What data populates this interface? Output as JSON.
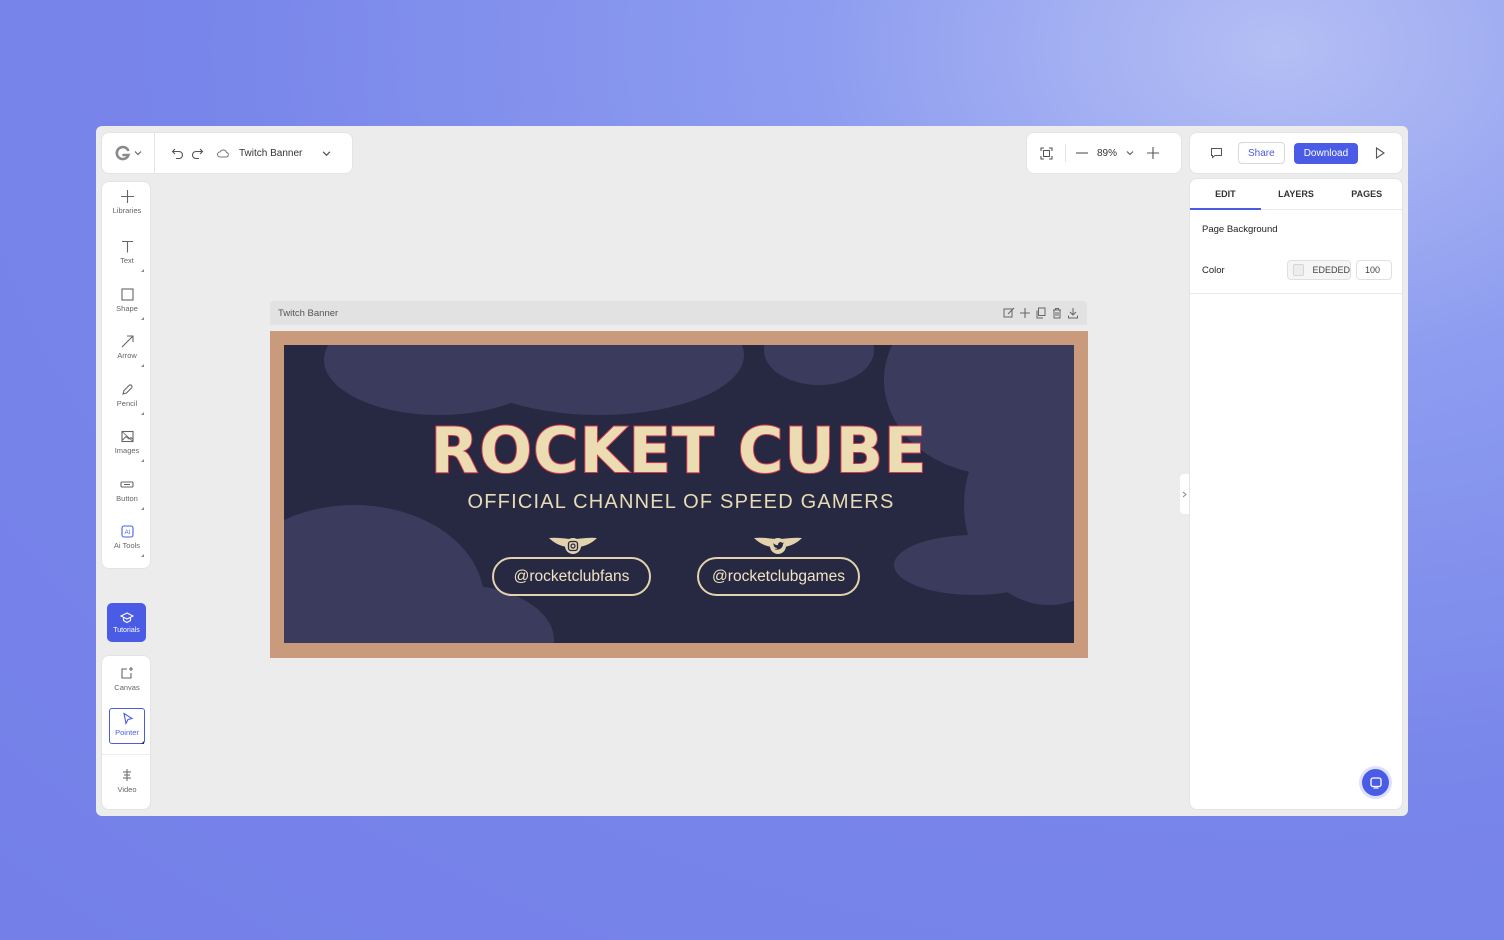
{
  "header": {
    "document_title": "Twitch Banner",
    "zoom_level": "89%",
    "share_label": "Share",
    "download_label": "Download"
  },
  "tools": [
    {
      "label": "Libraries",
      "icon": "plus-icon"
    },
    {
      "label": "Text",
      "icon": "text-icon"
    },
    {
      "label": "Shape",
      "icon": "square-icon"
    },
    {
      "label": "Arrow",
      "icon": "arrow-icon"
    },
    {
      "label": "Pencil",
      "icon": "pencil-icon"
    },
    {
      "label": "Images",
      "icon": "image-icon"
    },
    {
      "label": "Button",
      "icon": "button-icon"
    },
    {
      "label": "Ai Tools",
      "icon": "ai-icon"
    }
  ],
  "tutorials_label": "Tutorials",
  "bottom_tools": [
    {
      "label": "Canvas",
      "icon": "canvas-icon"
    },
    {
      "label": "Pointer",
      "icon": "pointer-icon"
    },
    {
      "label": "Video",
      "icon": "video-icon"
    }
  ],
  "artboard": {
    "name": "Twitch Banner"
  },
  "banner": {
    "title": "ROCKET CUBE",
    "subtitle": "OFFICIAL CHANNEL OF SPEED GAMERS",
    "handle_instagram": "@rocketclubfans",
    "handle_twitter": "@rocketclubgames",
    "frame_color": "#c99a7c",
    "background_color": "#272841",
    "title_color": "#ecdcb2",
    "title_outline_color": "#d43b52"
  },
  "right_panel": {
    "tabs": [
      "EDIT",
      "LAYERS",
      "PAGES"
    ],
    "active_tab": "EDIT",
    "section_title": "Page Background",
    "color_label": "Color",
    "color_hex": "EDEDED",
    "opacity": "100"
  },
  "accent_color": "#4a5ce6"
}
